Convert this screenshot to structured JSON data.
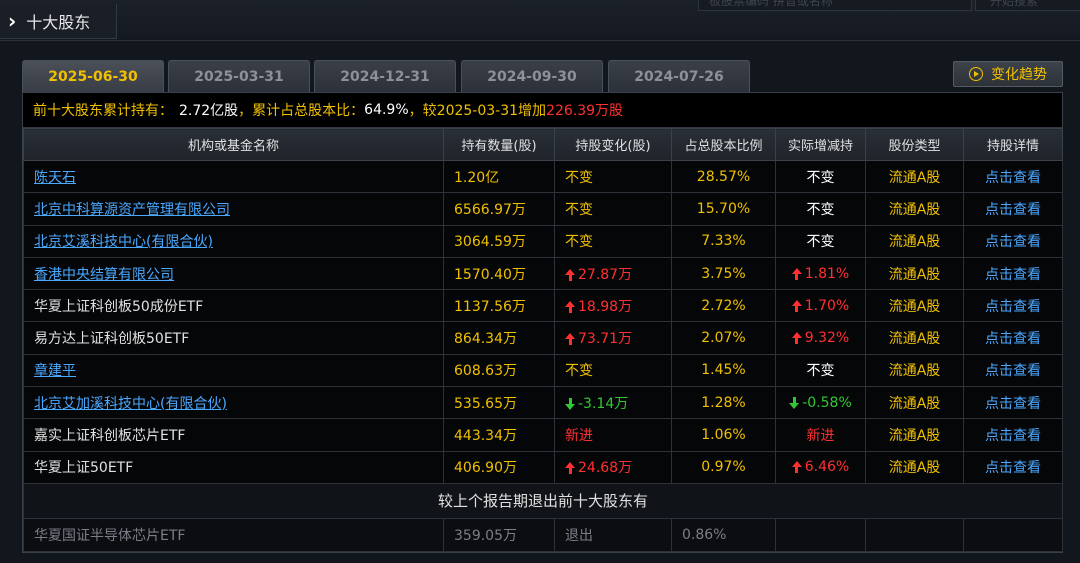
{
  "header": {
    "section_title": "十大股东",
    "search_placeholder": "板股票编码 拼音或名称",
    "search_button": "开始搜索"
  },
  "tabs": [
    "2025-06-30",
    "2025-03-31",
    "2024-12-31",
    "2024-09-30",
    "2024-07-26"
  ],
  "active_tab": 0,
  "trend_button": "变化趋势",
  "summary": {
    "label": "前十大股东累计持有：",
    "shares": "2.72亿股",
    "ratio_label": "，累计占总股本比：",
    "ratio": "64.9%",
    "compare_label": "，较2025-03-31增加",
    "change": "226.39万股"
  },
  "columns": [
    "机构或基金名称",
    "持有数量(股)",
    "持股变化(股)",
    "占总股本比例",
    "实际增减持",
    "股份类型",
    "持股详情"
  ],
  "rows": [
    {
      "name": "陈天石",
      "link": true,
      "qty": "1.20亿",
      "chg": "不变",
      "chg_dir": "none",
      "pct": "28.57%",
      "real": "不变",
      "real_dir": "none",
      "type": "流通A股",
      "detail": "点击查看"
    },
    {
      "name": "北京中科算源资产管理有限公司",
      "link": true,
      "qty": "6566.97万",
      "chg": "不变",
      "chg_dir": "none",
      "pct": "15.70%",
      "real": "不变",
      "real_dir": "none",
      "type": "流通A股",
      "detail": "点击查看"
    },
    {
      "name": "北京艾溪科技中心(有限合伙)",
      "link": true,
      "qty": "3064.59万",
      "chg": "不变",
      "chg_dir": "none",
      "pct": "7.33%",
      "real": "不变",
      "real_dir": "none",
      "type": "流通A股",
      "detail": "点击查看"
    },
    {
      "name": "香港中央结算有限公司",
      "link": true,
      "qty": "1570.40万",
      "chg": "27.87万",
      "chg_dir": "up",
      "pct": "3.75%",
      "real": "1.81%",
      "real_dir": "up",
      "type": "流通A股",
      "detail": "点击查看"
    },
    {
      "name": "华夏上证科创板50成份ETF",
      "link": false,
      "qty": "1137.56万",
      "chg": "18.98万",
      "chg_dir": "up",
      "pct": "2.72%",
      "real": "1.70%",
      "real_dir": "up",
      "type": "流通A股",
      "detail": "点击查看"
    },
    {
      "name": "易方达上证科创板50ETF",
      "link": false,
      "qty": "864.34万",
      "chg": "73.71万",
      "chg_dir": "up",
      "pct": "2.07%",
      "real": "9.32%",
      "real_dir": "up",
      "type": "流通A股",
      "detail": "点击查看"
    },
    {
      "name": "章建平",
      "link": true,
      "qty": "608.63万",
      "chg": "不变",
      "chg_dir": "none",
      "pct": "1.45%",
      "real": "不变",
      "real_dir": "none",
      "type": "流通A股",
      "detail": "点击查看"
    },
    {
      "name": "北京艾加溪科技中心(有限合伙)",
      "link": true,
      "qty": "535.65万",
      "chg": "-3.14万",
      "chg_dir": "down",
      "pct": "1.28%",
      "real": "-0.58%",
      "real_dir": "down",
      "type": "流通A股",
      "detail": "点击查看"
    },
    {
      "name": "嘉实上证科创板芯片ETF",
      "link": false,
      "qty": "443.34万",
      "chg": "新进",
      "chg_dir": "new",
      "pct": "1.06%",
      "real": "新进",
      "real_dir": "new",
      "type": "流通A股",
      "detail": "点击查看"
    },
    {
      "name": "华夏上证50ETF",
      "link": false,
      "qty": "406.90万",
      "chg": "24.68万",
      "chg_dir": "up",
      "pct": "0.97%",
      "real": "6.46%",
      "real_dir": "up",
      "type": "流通A股",
      "detail": "点击查看"
    }
  ],
  "exit_section": {
    "title": "较上个报告期退出前十大股东有",
    "rows": [
      {
        "name": "华夏国证半导体芯片ETF",
        "qty": "359.05万",
        "chg": "退出",
        "pct": "0.86%"
      }
    ]
  },
  "colors": {
    "accent": "#f0c000",
    "up": "#ff3030",
    "down": "#32c832",
    "link": "#4aa8ff"
  }
}
